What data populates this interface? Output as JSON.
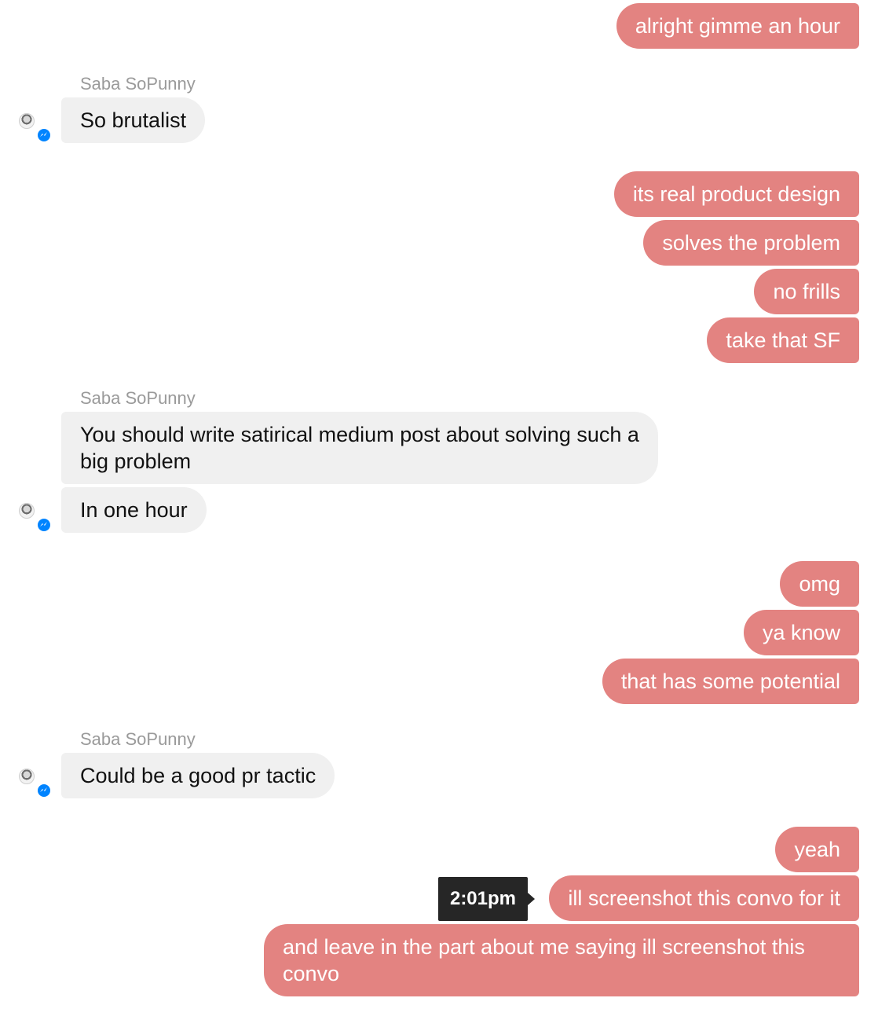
{
  "sender_name": "Saba SoPunny",
  "messages": [
    {
      "from": "me",
      "text": "alright gimme an hour"
    },
    {
      "from": "them",
      "text": "So brutalist"
    },
    {
      "from": "me",
      "text": "its real product design"
    },
    {
      "from": "me",
      "text": "solves the problem"
    },
    {
      "from": "me",
      "text": "no frills"
    },
    {
      "from": "me",
      "text": "take that SF"
    },
    {
      "from": "them",
      "text": "You should write satirical medium post about solving such a big problem"
    },
    {
      "from": "them",
      "text": "In one hour"
    },
    {
      "from": "me",
      "text": "omg"
    },
    {
      "from": "me",
      "text": "ya know"
    },
    {
      "from": "me",
      "text": "that has some potential"
    },
    {
      "from": "them",
      "text": "Could be a good pr tactic"
    },
    {
      "from": "me",
      "text": "yeah"
    },
    {
      "from": "me",
      "text": "ill screenshot this convo for it"
    },
    {
      "from": "me",
      "text": "and leave in the part about me saying ill screenshot this convo"
    }
  ],
  "tooltip": {
    "time": "2:01pm"
  },
  "icons": {
    "avatar": "avatar-icon",
    "badge": "messenger-badge-icon",
    "badge_color": "#0084ff"
  },
  "colors": {
    "my_bubble": "#e38381",
    "their_bubble": "#f0f0f0"
  }
}
